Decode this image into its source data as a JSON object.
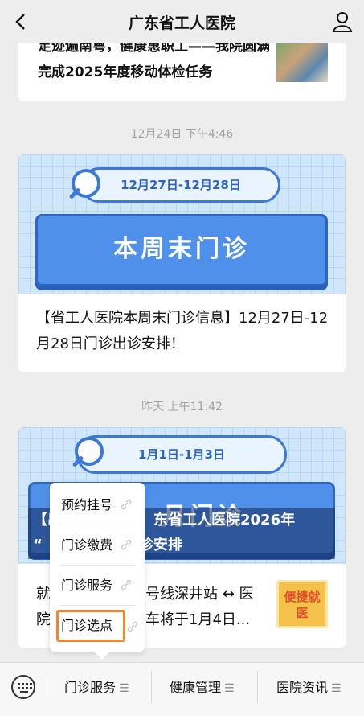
{
  "header": {
    "title": "广东省工人医院"
  },
  "articles": [
    {
      "text": "足迹遍南粤，健康惠职工——我院圆满完成2025年度移动体检任务"
    },
    {
      "time": "12月24日 下午4:46",
      "banner_date": "12月27日-12月28日",
      "banner_title": "本周末门诊",
      "text": "【省工人医院本周末门诊信息】12月27日-12月28日门诊出诊安排！"
    },
    {
      "time": "昨天 上午11:42",
      "banner_date": "1月1日-1月3日",
      "banner_title_partial": "月门诊",
      "overlay_line1": "【出",
      "overlay_line1b": "东省工人医院2026年",
      "overlay_line2": "“",
      "overlay_line2b": "诊安排",
      "text_a": "就",
      "text_b": "号线深井站 ↔ 医",
      "text_c": "院",
      "text_d": "车将于1月4日...",
      "badge": "便捷就医"
    }
  ],
  "popup_menu": {
    "items": [
      {
        "label": "预约挂号"
      },
      {
        "label": "门诊缴费"
      },
      {
        "label": "门诊服务"
      },
      {
        "label": "门诊选点",
        "selected": true
      }
    ]
  },
  "bottom_nav": {
    "items": [
      {
        "label": "门诊服务"
      },
      {
        "label": "健康管理"
      },
      {
        "label": "医院资讯"
      }
    ]
  },
  "colors": {
    "accent": "#4f90ea",
    "highlight": "#f0862f"
  }
}
